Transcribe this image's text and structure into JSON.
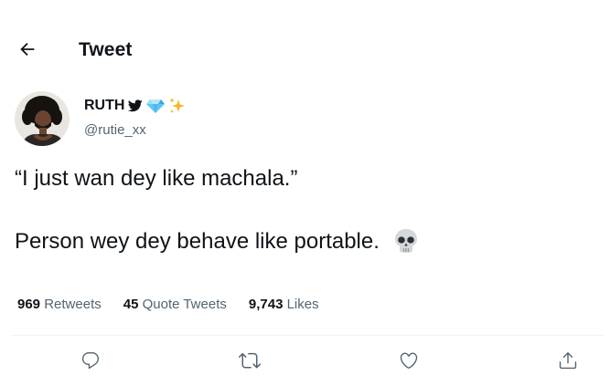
{
  "header": {
    "back_icon": "arrow-left-icon",
    "title": "Tweet"
  },
  "author": {
    "display_name": "RUTH",
    "badges": [
      "twitter-bird-icon",
      "gem-icon",
      "sparkles-icon"
    ],
    "handle": "@rutie_xx"
  },
  "tweet": {
    "line1": "“I just wan dey like machala.”",
    "line2": "Person wey dey behave like portable.",
    "emoji": "skull-icon"
  },
  "stats": [
    {
      "number": "969",
      "label": "Retweets"
    },
    {
      "number": "45",
      "label": "Quote Tweets"
    },
    {
      "number": "9,743",
      "label": "Likes"
    }
  ],
  "actions": [
    "reply-icon",
    "retweet-icon",
    "like-icon",
    "share-icon"
  ],
  "colors": {
    "text_primary": "#0f1419",
    "text_secondary": "#536471",
    "divider": "#eff3f4",
    "twitter_blue": "#1d9bf0"
  }
}
